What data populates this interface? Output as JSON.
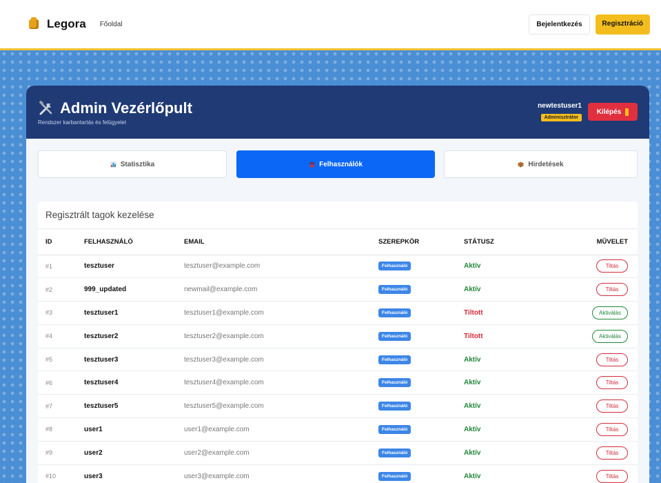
{
  "navbar": {
    "brand": "Legora",
    "home_link": "Főoldal",
    "login_label": "Bejelentkezés",
    "register_label": "Regisztráció"
  },
  "header": {
    "title": "Admin Vezérlőpult",
    "subtitle": "Rendszer karbantartás és felügyelet",
    "username": "newtestuser1",
    "role": "Adminisztrátor",
    "logout_label": "Kilépés"
  },
  "tabs": [
    {
      "label": "Statisztika",
      "icon": "bar-chart-icon",
      "active": false
    },
    {
      "label": "Felhasználók",
      "icon": "users-icon",
      "active": true
    },
    {
      "label": "Hirdetések",
      "icon": "box-icon",
      "active": false
    }
  ],
  "table": {
    "title": "Regisztrált tagok kezelése",
    "columns": {
      "id": "ID",
      "user": "FELHASZNÁLÓ",
      "email": "EMAIL",
      "role": "SZEREPKÖR",
      "status": "STÁTUSZ",
      "action": "MŰVELET"
    },
    "rows": [
      {
        "id": "#1",
        "user": "tesztuser",
        "email": "tesztuser@example.com",
        "role": "Felhasználó",
        "status": "Aktív",
        "action": "Tiltás"
      },
      {
        "id": "#2",
        "user": "999_updated",
        "email": "newmail@example.com",
        "role": "Felhasználó",
        "status": "Aktív",
        "action": "Tiltás"
      },
      {
        "id": "#3",
        "user": "tesztuser1",
        "email": "tesztuser1@example.com",
        "role": "Felhasználó",
        "status": "Tiltott",
        "action": "Aktiválás"
      },
      {
        "id": "#4",
        "user": "tesztuser2",
        "email": "tesztuser2@example.com",
        "role": "Felhasználó",
        "status": "Tiltott",
        "action": "Aktiválás"
      },
      {
        "id": "#5",
        "user": "tesztuser3",
        "email": "tesztuser3@example.com",
        "role": "Felhasználó",
        "status": "Aktív",
        "action": "Tiltás"
      },
      {
        "id": "#6",
        "user": "tesztuser4",
        "email": "tesztuser4@example.com",
        "role": "Felhasználó",
        "status": "Aktív",
        "action": "Tiltás"
      },
      {
        "id": "#7",
        "user": "tesztuser5",
        "email": "tesztuser5@example.com",
        "role": "Felhasználó",
        "status": "Aktív",
        "action": "Tiltás"
      },
      {
        "id": "#8",
        "user": "user1",
        "email": "user1@example.com",
        "role": "Felhasználó",
        "status": "Aktív",
        "action": "Tiltás"
      },
      {
        "id": "#9",
        "user": "user2",
        "email": "user2@example.com",
        "role": "Felhasználó",
        "status": "Aktív",
        "action": "Tiltás"
      },
      {
        "id": "#10",
        "user": "user3",
        "email": "user3@example.com",
        "role": "Felhasználó",
        "status": "Aktív",
        "action": "Tiltás"
      }
    ]
  },
  "colors": {
    "accent_yellow": "#f4bd1e",
    "header_navy": "#1f3a75",
    "active_tab_blue": "#0b67f5",
    "danger_red": "#d12b3a",
    "success_green": "#22863a"
  }
}
